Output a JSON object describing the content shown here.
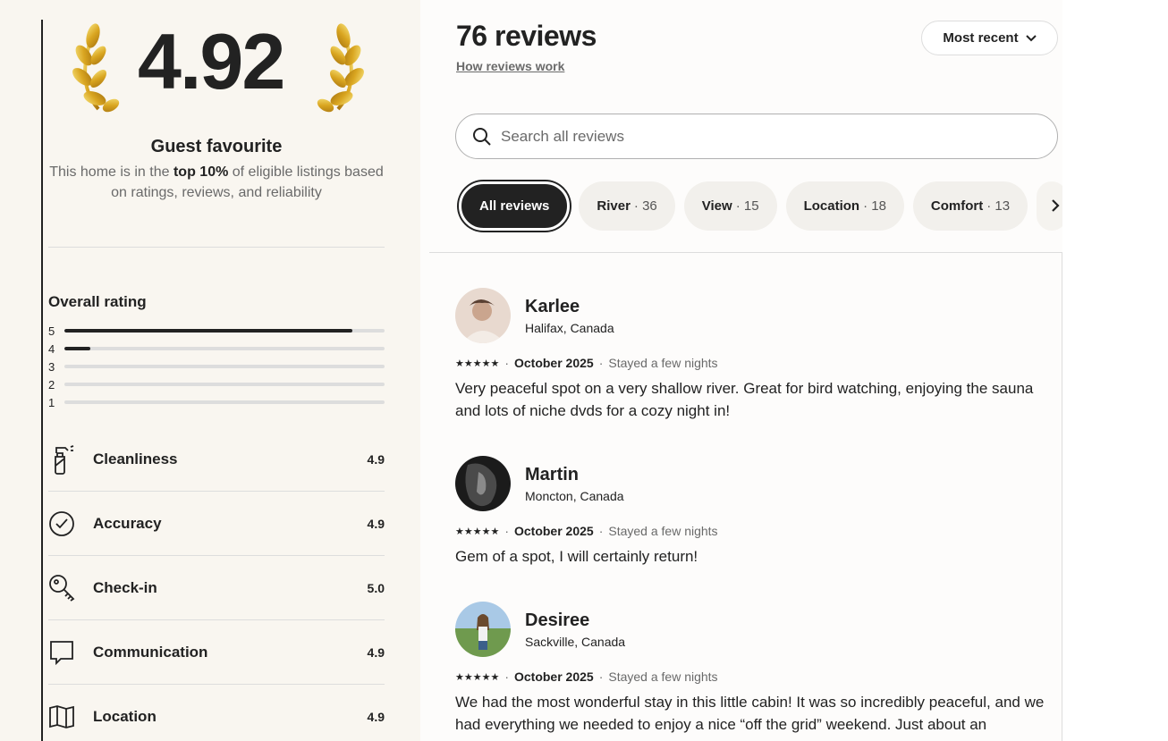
{
  "hero": {
    "rating": "4.92",
    "title": "Guest favourite",
    "subtitle_pre": "This home is in the ",
    "subtitle_bold": "top 10%",
    "subtitle_post": " of eligible listings based on ratings, reviews, and reliability"
  },
  "overall": {
    "label": "Overall rating",
    "bars": [
      {
        "star": "5",
        "fraction": 0.9
      },
      {
        "star": "4",
        "fraction": 0.08
      },
      {
        "star": "3",
        "fraction": 0
      },
      {
        "star": "2",
        "fraction": 0
      },
      {
        "star": "1",
        "fraction": 0
      }
    ]
  },
  "categories": [
    {
      "name": "Cleanliness",
      "value": "4.9",
      "icon": "spray-bottle-icon"
    },
    {
      "name": "Accuracy",
      "value": "4.9",
      "icon": "check-circle-icon"
    },
    {
      "name": "Check-in",
      "value": "5.0",
      "icon": "key-icon"
    },
    {
      "name": "Communication",
      "value": "4.9",
      "icon": "chat-bubble-icon"
    },
    {
      "name": "Location",
      "value": "4.9",
      "icon": "map-icon"
    }
  ],
  "reviews_header": {
    "title": "76 reviews",
    "how_link": "How reviews work",
    "sort_label": "Most recent",
    "search_placeholder": "Search all reviews"
  },
  "chips": [
    {
      "label": "All reviews",
      "count": "",
      "active": true
    },
    {
      "label": "River",
      "count": "· 36",
      "active": false
    },
    {
      "label": "View",
      "count": "· 15",
      "active": false
    },
    {
      "label": "Location",
      "count": "· 18",
      "active": false
    },
    {
      "label": "Comfort",
      "count": "· 13",
      "active": false
    }
  ],
  "reviews": [
    {
      "name": "Karlee",
      "location": "Halifax, Canada",
      "stars": "★★★★★",
      "date": "October 2025",
      "stay": "Stayed a few nights",
      "text": "Very peaceful spot on a very shallow river. Great for bird watching, enjoying the sauna and lots of niche dvds for a cozy night in!"
    },
    {
      "name": "Martin",
      "location": "Moncton, Canada",
      "stars": "★★★★★",
      "date": "October 2025",
      "stay": "Stayed a few nights",
      "text": "Gem of a spot, I will certainly return!"
    },
    {
      "name": "Desiree",
      "location": "Sackville, Canada",
      "stars": "★★★★★",
      "date": "October 2025",
      "stay": "Stayed a few nights",
      "text": "We had the most wonderful stay in this little cabin! It was so incredibly peaceful, and we had everything we needed to enjoy a nice “off the grid” weekend. Just about an"
    }
  ],
  "separator": "·"
}
